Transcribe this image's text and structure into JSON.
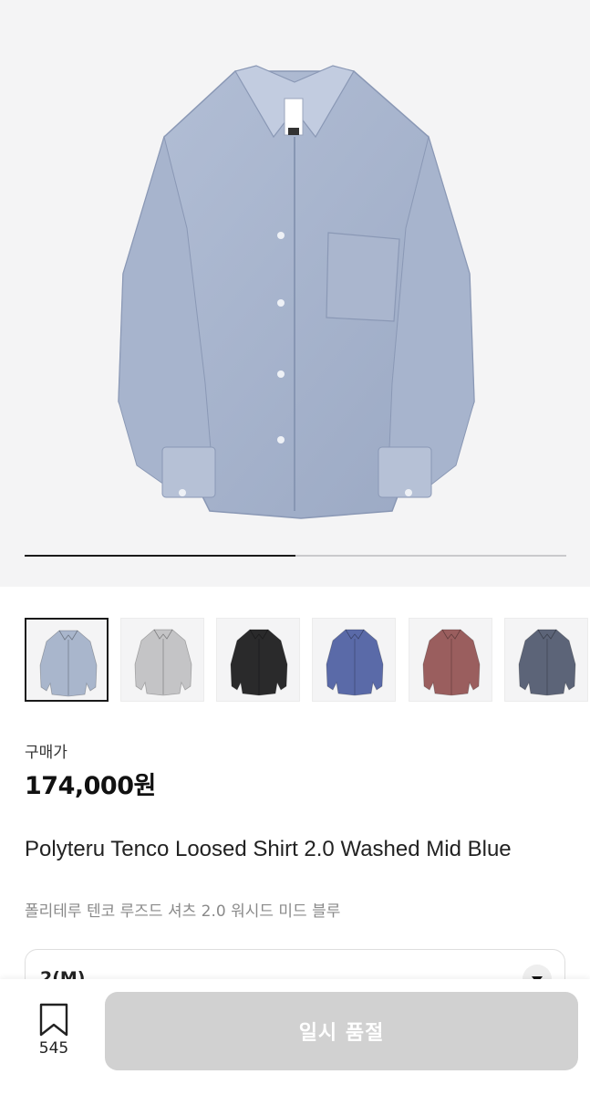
{
  "hero": {
    "image": "shirt-product-photo",
    "carousel_progress": 0.5
  },
  "thumbnails": [
    {
      "color": "#a9b6cc",
      "selected": true
    },
    {
      "color": "#c4c4c6",
      "selected": false
    },
    {
      "color": "#2a2a2b",
      "selected": false
    },
    {
      "color": "#5a6aa8",
      "selected": false
    },
    {
      "color": "#9a5e5e",
      "selected": false
    },
    {
      "color": "#5c6478",
      "selected": false
    }
  ],
  "price": {
    "label": "구매가",
    "value": "174,000원"
  },
  "product": {
    "title": "Polyteru Tenco Loosed Shirt 2.0 Washed Mid Blue",
    "subtitle": "폴리테루 텐코 루즈드 셔츠 2.0 워시드 미드 블루"
  },
  "size": {
    "selected": "2(M)",
    "icon": "chevron-down-icon"
  },
  "bottom": {
    "wish_icon": "bookmark-icon",
    "wish_count": "545",
    "buy_label": "일시 품절"
  }
}
